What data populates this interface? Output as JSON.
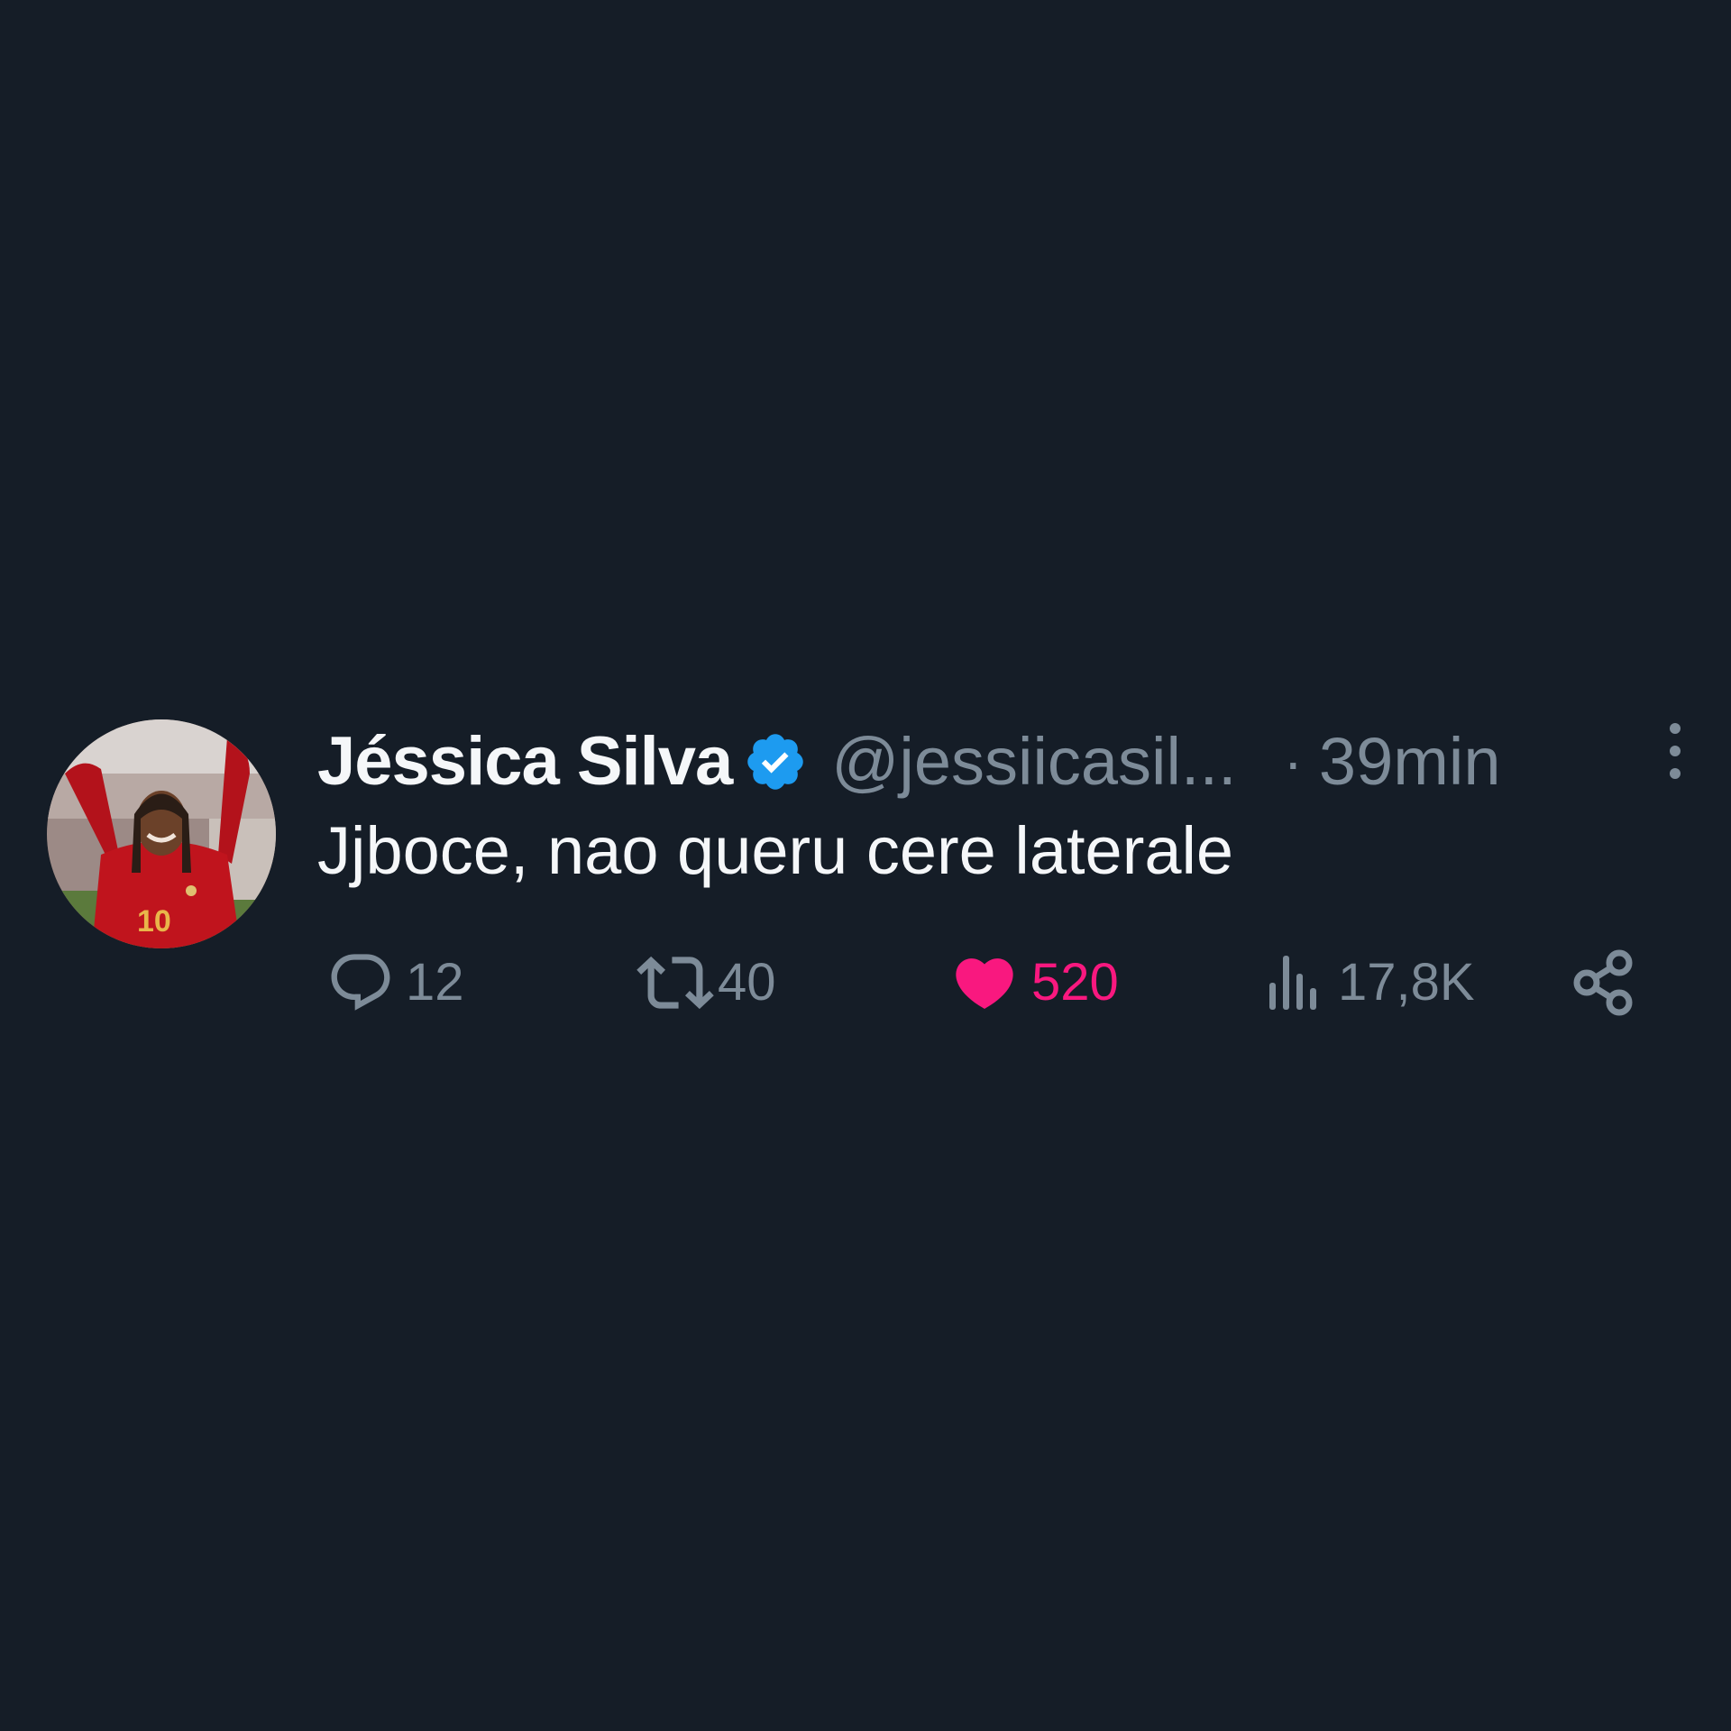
{
  "tweet": {
    "display_name": "Jéssica Silva",
    "verified_icon": "verified-badge-icon",
    "handle": "@jessiicasil...",
    "separator": "·",
    "time": "39min",
    "text": "Jjboce, nao queru cere laterale",
    "actions": {
      "reply_count": "12",
      "retweet_count": "40",
      "like_count": "520",
      "views_count": "17,8K"
    }
  },
  "colors": {
    "background": "#151d27",
    "text_primary": "#f5f7f9",
    "text_secondary": "#7d8b98",
    "verified_blue": "#1d9bf0",
    "like_pink": "#f9187f"
  }
}
